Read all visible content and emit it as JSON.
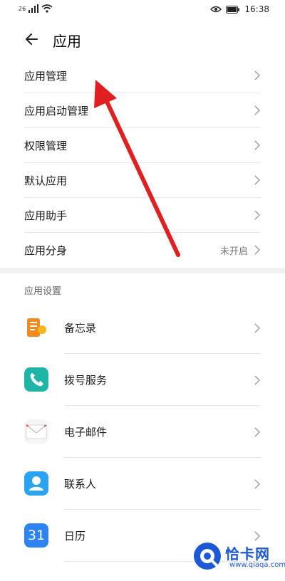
{
  "status_bar": {
    "network_label": "26",
    "time": "16:38"
  },
  "header": {
    "title": "应用"
  },
  "menu": {
    "items": [
      {
        "label": "应用管理"
      },
      {
        "label": "应用启动管理"
      },
      {
        "label": "权限管理"
      },
      {
        "label": "默认应用"
      },
      {
        "label": "应用助手"
      },
      {
        "label": "应用分身",
        "value": "未开启"
      }
    ]
  },
  "section": {
    "title": "应用设置"
  },
  "apps": [
    {
      "label": "备忘录",
      "icon": "notes-icon"
    },
    {
      "label": "拨号服务",
      "icon": "phone-icon"
    },
    {
      "label": "电子邮件",
      "icon": "mail-icon"
    },
    {
      "label": "联系人",
      "icon": "contacts-icon"
    },
    {
      "label": "日历",
      "icon": "calendar-icon",
      "icon_text": "31"
    }
  ],
  "watermark": {
    "text": "恰卡网",
    "url": "www.qiaqa.com"
  },
  "colors": {
    "arrow": "#e02020",
    "phone": "#1fb5a6",
    "contacts": "#2aa3f0",
    "calendar": "#2d83f1",
    "notes": "#f28a1f"
  }
}
